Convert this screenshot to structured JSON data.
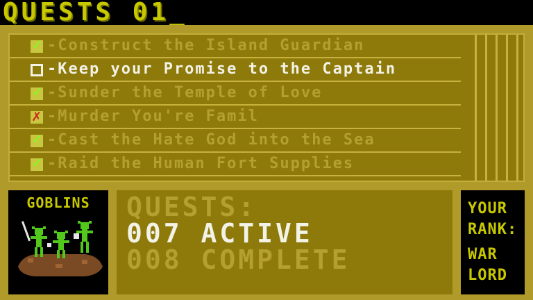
{
  "header": {
    "title": "QUESTS 01_"
  },
  "quests": [
    {
      "label": "-Construct the Island Guardian",
      "state": "checked"
    },
    {
      "label": "-Keep your Promise to the Captain",
      "state": "empty"
    },
    {
      "label": "-Sunder the Temple of Love",
      "state": "checked"
    },
    {
      "label": "-Murder You're Famil",
      "state": "failed"
    },
    {
      "label": "-Cast the Hate God into the Sea",
      "state": "checked"
    },
    {
      "label": "-Raid the Human Fort Supplies",
      "state": "checked"
    }
  ],
  "faction": {
    "label": "GOBLINS"
  },
  "stats": {
    "heading": "QUESTS:",
    "active": "007 ACTIVE",
    "complete": "008 COMPLETE"
  },
  "rank": {
    "line1": "YOUR",
    "line2": "RANK:",
    "line3": "WAR",
    "line4": "LORD"
  },
  "colors": {
    "panel": "#b09a2a",
    "panel_dark": "#8e7a0a",
    "text_dim": "#b4a030",
    "text_bright": "#f2f2e6",
    "yellow": "#c8c800",
    "check_green": "#7dff1a",
    "cross_red": "#d42020"
  }
}
